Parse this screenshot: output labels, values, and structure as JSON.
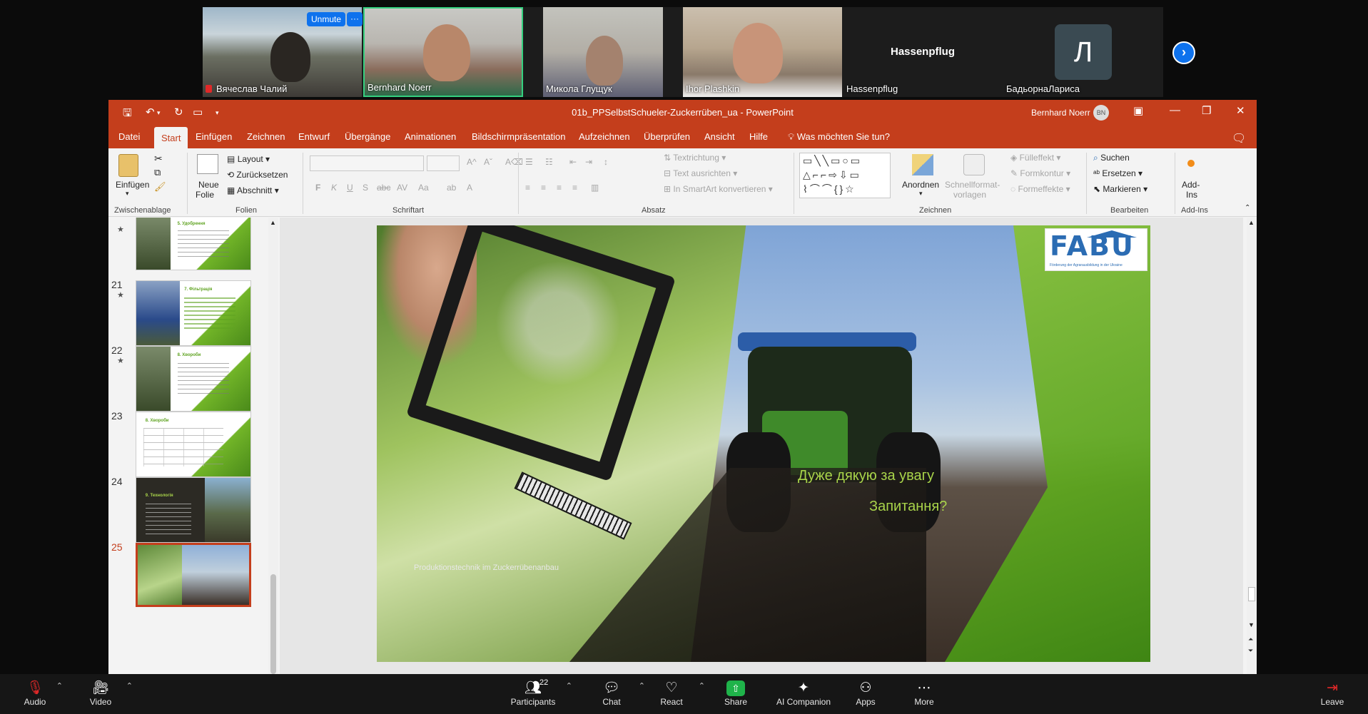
{
  "zoom": {
    "participants": [
      {
        "name": "Вячеслав Чалий"
      },
      {
        "name": "Bernhard Noerr"
      },
      {
        "name": "Микола Глущук"
      },
      {
        "name": "Ihor Plashkin"
      },
      {
        "name": "Hassenpflug",
        "display": "Hassenpflug"
      },
      {
        "name": "БадьорнаЛариса",
        "initial": "Л"
      }
    ],
    "unmute_label": "Unmute",
    "more_label": "···",
    "toolbar": {
      "audio": "Audio",
      "video": "Video",
      "participants": "Participants",
      "participants_count": "22",
      "chat": "Chat",
      "react": "React",
      "share": "Share",
      "ai_companion": "AI Companion",
      "apps": "Apps",
      "more": "More",
      "leave": "Leave"
    }
  },
  "ppt": {
    "window_title": "01b_PPSelbstSchueler-Zuckerrüben_ua  -  PowerPoint",
    "user_name": "Bernhard Noerr",
    "user_initials": "BN",
    "menu": [
      "Datei",
      "Start",
      "Einfügen",
      "Zeichnen",
      "Entwurf",
      "Übergänge",
      "Animationen",
      "Bildschirmpräsentation",
      "Aufzeichnen",
      "Überprüfen",
      "Ansicht",
      "Hilfe"
    ],
    "active_menu": "Start",
    "tell_me": "Was möchten Sie tun?",
    "ribbon": {
      "paste": "Einfügen",
      "clipboard": "Zwischenablage",
      "new_slide_1": "Neue",
      "new_slide_2": "Folie",
      "layout": "Layout",
      "reset": "Zurücksetzen",
      "section": "Abschnitt",
      "slides": "Folien",
      "font": "Schriftart",
      "paragraph": "Absatz",
      "text_direction": "Textrichtung",
      "align_text": "Text ausrichten",
      "smartart": "In SmartArt konvertieren",
      "arrange": "Anordnen",
      "quick_styles_1": "Schnellformat-",
      "quick_styles_2": "vorlagen",
      "fill": "Fülleffekt",
      "outline": "Formkontur",
      "effects": "Formeffekte",
      "drawing": "Zeichnen",
      "find": "Suchen",
      "replace": "Ersetzen",
      "select": "Markieren",
      "editing": "Bearbeiten",
      "addins_1": "Add-",
      "addins_2": "Ins",
      "addins_group": "Add-Ins"
    },
    "thumbnails": [
      {
        "num": "",
        "title": "5. Удобрення",
        "star": true
      },
      {
        "num": "21",
        "title": "7. Фільтрація",
        "star": true
      },
      {
        "num": "22",
        "title": "8. Хвороби",
        "star": true
      },
      {
        "num": "23",
        "title": "8. Хвороби",
        "star": false
      },
      {
        "num": "24",
        "title": "9. Технологія",
        "star": false
      },
      {
        "num": "25",
        "title": "",
        "star": false,
        "current": true
      }
    ],
    "slide": {
      "line1": "Дуже дякую за увагу",
      "line2": "Запитання?",
      "footer": "Produktionstechnik im Zuckerrübenanbau",
      "logo": "FABU",
      "logo_sub": "Förderung der Agrarausbildung in der Ukraine"
    }
  }
}
